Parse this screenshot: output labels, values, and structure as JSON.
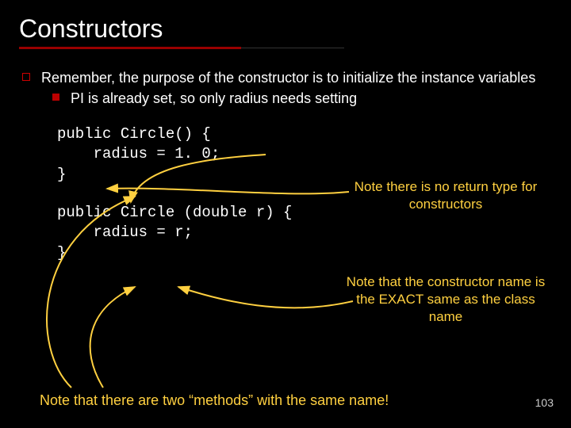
{
  "title": "Constructors",
  "bullet1": "Remember, the purpose of the constructor is to initialize the instance variables",
  "subbullet1": "PI is already set, so only radius needs setting",
  "code1": "public Circle() {\n    radius = 1. 0;\n}",
  "code2": "public Circle (double r) {\n    radius = r;\n}",
  "note1": "Note there is no return type for constructors",
  "note2": "Note that the constructor name is the EXACT same as the class name",
  "bottom_note": "Note that there are two “methods” with the same name!",
  "page_number": "103"
}
